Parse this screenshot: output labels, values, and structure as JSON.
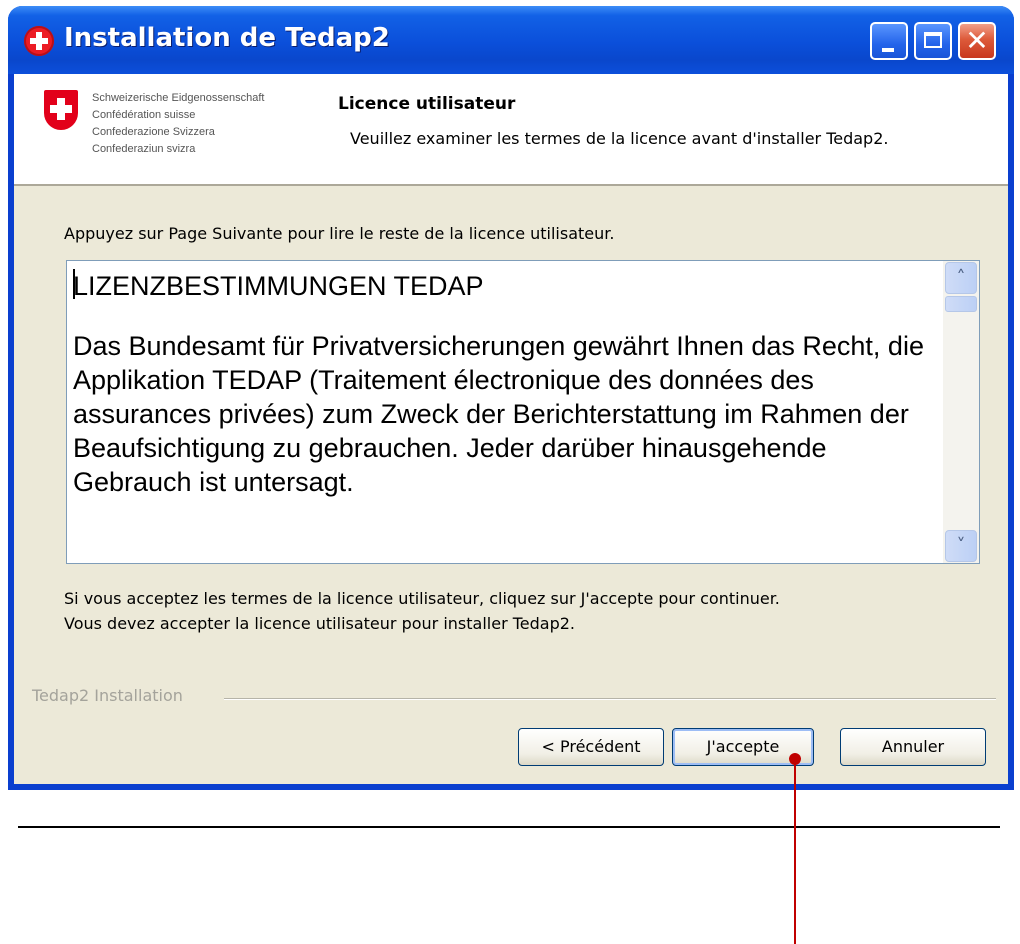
{
  "window": {
    "title": "Installation de Tedap2",
    "close_glyph": "✕"
  },
  "header": {
    "logo_lines": [
      "Schweizerische Eidgenossenschaft",
      "Confédération suisse",
      "Confederazione Svizzera",
      "Confederaziun svizra"
    ],
    "title": "Licence utilisateur",
    "subtitle": "Veuillez examiner les termes de la licence avant d'installer Tedap2."
  },
  "body": {
    "instruction": "Appuyez sur Page Suivante pour lire le reste de la licence utilisateur.",
    "license": {
      "heading": "LIZENZBESTIMMUNGEN TEDAP",
      "paragraph": "Das Bundesamt für Privatversicherungen gewährt Ihnen das Recht, die Applikation TEDAP (Traitement électronique des données des assurances privées) zum Zweck der Berichterstattung im Rahmen der Beaufsichtigung zu gebrauchen. Jeder darüber hinausgehende Gebrauch ist untersagt."
    },
    "accept_note_line1": "Si vous acceptez les termes de la licence utilisateur, cliquez sur J'accepte pour continuer.",
    "accept_note_line2": "Vous devez accepter la licence utilisateur pour installer Tedap2."
  },
  "footer": {
    "branding": "Tedap2 Installation",
    "buttons": {
      "previous": "< Précédent",
      "accept": "J'accepte",
      "cancel": "Annuler"
    }
  },
  "icons": {
    "title": "swiss-cross-icon",
    "logo": "swiss-shield-icon",
    "scroll_up": "chevron-up-icon",
    "scroll_down": "chevron-down-icon"
  },
  "colors": {
    "titlebar": "#0b4fda",
    "dialog_background": "#ece9d8",
    "close_button": "#dd5a3a",
    "callout": "#c00000",
    "swiss_red": "#e2001a"
  }
}
